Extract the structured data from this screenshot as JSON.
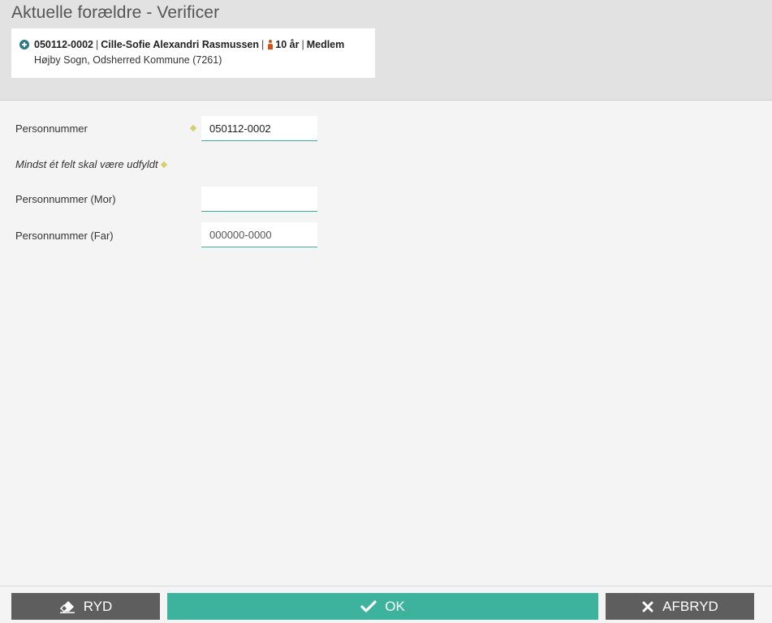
{
  "header": {
    "title": "Aktuelle forældre - Verificer",
    "person": {
      "cpr": "050112-0002",
      "name": "Cille-Sofie Alexandri Rasmussen",
      "age": "10 år",
      "status": "Medlem",
      "separator": "|",
      "location": "Højby Sogn, Odsherred Kommune (7261)"
    }
  },
  "form": {
    "personnummer": {
      "label": "Personnummer",
      "value": "050112-0002"
    },
    "hint": "Mindst ét felt skal være udfyldt",
    "mor": {
      "label": "Personnummer (Mor)",
      "value": ""
    },
    "far": {
      "label": "Personnummer (Far)",
      "placeholder": "000000-0000"
    }
  },
  "footer": {
    "ryd_label": "RYD",
    "ok_label": "OK",
    "afbryd_label": "AFBRYD"
  },
  "colors": {
    "accent": "#3db39e",
    "dark_button": "#5e5e5e",
    "required_marker": "#d6cf70",
    "gender_icon": "#d0531a"
  },
  "icons": {
    "expand": "plus-circle-icon",
    "gender": "female-person-icon",
    "ryd": "eraser-icon",
    "ok": "checkmark-icon",
    "afbryd": "close-icon",
    "required": "diamond-icon"
  }
}
